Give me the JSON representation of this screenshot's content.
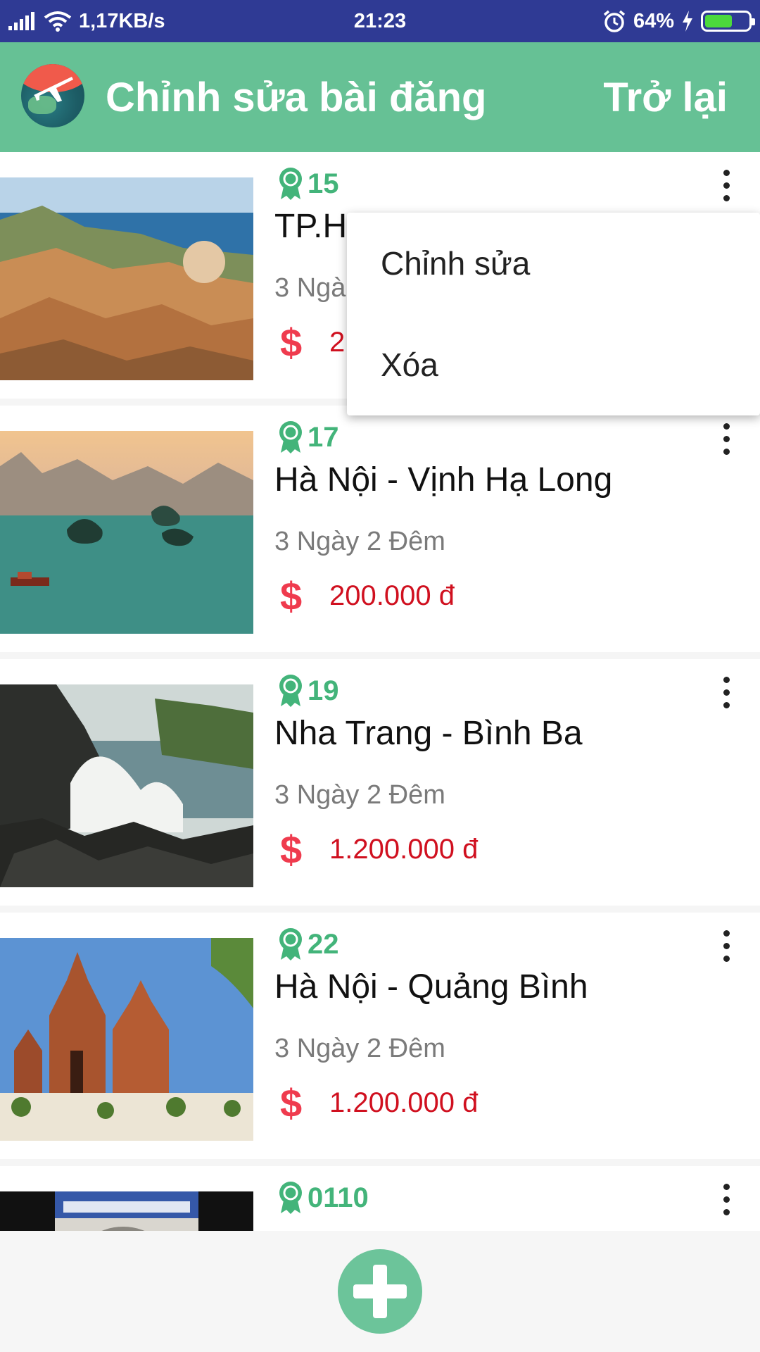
{
  "status": {
    "speed": "1,17KB/s",
    "time": "21:23",
    "battery_pct": "64%",
    "battery_level": 0.64
  },
  "appbar": {
    "title": "Chỉnh sửa bài đăng",
    "back_label": "Trở lại"
  },
  "tours": [
    {
      "id": "15",
      "name": "TP.H",
      "duration": "3 Ngà",
      "price": "2"
    },
    {
      "id": "17",
      "name": "Hà Nội - Vịnh Hạ Long",
      "duration": "3 Ngày 2 Đêm",
      "price": "200.000 đ"
    },
    {
      "id": "19",
      "name": "Nha Trang - Bình Ba",
      "duration": "3 Ngày 2 Đêm",
      "price": "1.200.000 đ"
    },
    {
      "id": "22",
      "name": "Hà Nội - Quảng Bình",
      "duration": "3 Ngày 2 Đêm",
      "price": "1.200.000 đ"
    },
    {
      "id": "0110",
      "name": "",
      "duration": "",
      "price": ""
    }
  ],
  "popup_menu": {
    "edit_label": "Chỉnh sửa",
    "delete_label": "Xóa"
  },
  "icons": {
    "badge": "award-ribbon-icon",
    "price": "dollar-icon",
    "more": "more-vert-icon",
    "fab": "add-icon"
  },
  "colors": {
    "appbar": "#66c195",
    "statusbar": "#2f3a94",
    "badge": "#43b47a",
    "price": "#d0101f",
    "dollar": "#ef3b4e",
    "fab": "#6cc49a"
  }
}
